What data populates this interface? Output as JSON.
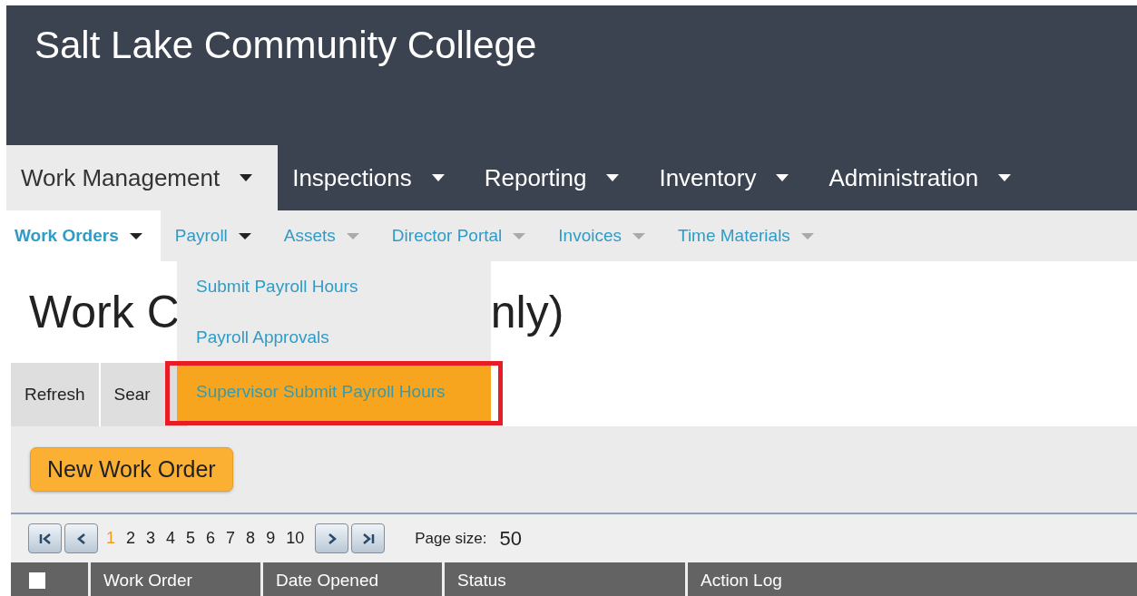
{
  "header": {
    "title": "Salt Lake Community College"
  },
  "main_nav": [
    {
      "label": "Work Management",
      "selected": true
    },
    {
      "label": "Inspections",
      "selected": false
    },
    {
      "label": "Reporting",
      "selected": false
    },
    {
      "label": "Inventory",
      "selected": false
    },
    {
      "label": "Administration",
      "selected": false
    }
  ],
  "sub_nav": [
    {
      "label": "Work Orders",
      "selected": true,
      "expanded": false
    },
    {
      "label": "Payroll",
      "selected": false,
      "expanded": true
    },
    {
      "label": "Assets",
      "selected": false,
      "expanded": false
    },
    {
      "label": "Director Portal",
      "selected": false,
      "expanded": false
    },
    {
      "label": "Invoices",
      "selected": false,
      "expanded": false
    },
    {
      "label": "Time Materials",
      "selected": false,
      "expanded": false
    }
  ],
  "dropdown": {
    "items": [
      {
        "label": "Submit Payroll Hours",
        "selected": false
      },
      {
        "label": "Payroll Approvals",
        "selected": false
      },
      {
        "label": "Supervisor Submit Payroll Hours",
        "selected": true
      }
    ]
  },
  "page_title_parts": [
    "Work C",
    "nly)"
  ],
  "toolbar": [
    "Refresh",
    "Sear"
  ],
  "new_button": "New Work Order",
  "pager": {
    "pages": [
      {
        "label": "1",
        "selected": true
      },
      {
        "label": "2",
        "selected": false
      },
      {
        "label": "3",
        "selected": false
      },
      {
        "label": "4",
        "selected": false
      },
      {
        "label": "5",
        "selected": false
      },
      {
        "label": "6",
        "selected": false
      },
      {
        "label": "7",
        "selected": false
      },
      {
        "label": "8",
        "selected": false
      },
      {
        "label": "9",
        "selected": false
      },
      {
        "label": "10",
        "selected": false
      }
    ],
    "page_size_label": "Page size:",
    "page_size": "50"
  },
  "table": {
    "select_all_checked": false,
    "columns": [
      "Work Order",
      "Date Opened",
      "Status",
      "Action Log"
    ]
  }
}
